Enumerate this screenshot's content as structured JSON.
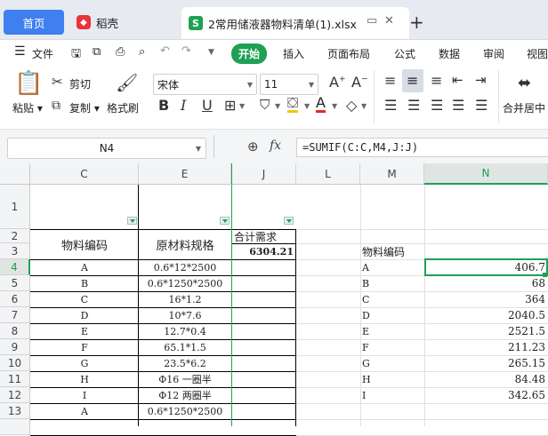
{
  "tabs": {
    "home": "首页",
    "daoke": "稻壳",
    "file": "2常用储液器物料清单(1).xlsx",
    "add": "+"
  },
  "menu": {
    "file": "文件",
    "start": "开始",
    "insert": "插入",
    "layout": "页面布局",
    "formula": "公式",
    "data": "数据",
    "review": "审阅",
    "view": "视图"
  },
  "ribbon": {
    "paste": "粘贴",
    "cut": "剪切",
    "copy": "复制",
    "format_painter": "格式刷",
    "font_name": "宋体",
    "font_size": "11",
    "merge": "合并居中"
  },
  "formula_bar": {
    "name_box": "N4",
    "fx": "fx",
    "formula": "=SUMIF(C:C,M4,J:J)"
  },
  "columns": [
    "C",
    "E",
    "J",
    "L",
    "M",
    "N"
  ],
  "rows": [
    "1",
    "2",
    "3",
    "4",
    "5",
    "6",
    "7",
    "8",
    "9",
    "10",
    "11",
    "12",
    "13"
  ],
  "table": {
    "header_code": "物料编码",
    "header_spec": "原材料规格",
    "header_total": "合计需求",
    "total_value": "6304.21",
    "codes": [
      "A",
      "B",
      "C",
      "D",
      "E",
      "F",
      "G",
      "H",
      "I",
      "A"
    ],
    "specs": [
      "0.6*12*2500",
      "0.6*1250*2500",
      "16*1.2",
      "10*7.6",
      "12.7*0.4",
      "65.1*1.5",
      "23.5*6.2",
      "Φ16 一圈半",
      "Φ12 两圈半",
      "0.6*1250*2500"
    ]
  },
  "summary": {
    "header": "物料编码",
    "codes": [
      "A",
      "B",
      "C",
      "D",
      "E",
      "F",
      "G",
      "H",
      "I"
    ],
    "values": [
      "406.7",
      "68",
      "364",
      "2040.5",
      "2521.5",
      "211.23",
      "265.15",
      "84.48",
      "342.65"
    ]
  },
  "colors": {
    "accent_green": "#1fa055",
    "tab_blue": "#3f7ff0"
  }
}
